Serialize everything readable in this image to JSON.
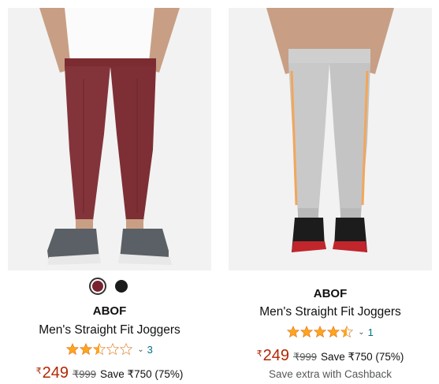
{
  "products": [
    {
      "brand": "ABOF",
      "title": "Men's Straight Fit Joggers",
      "rating": 2.5,
      "review_count": "3",
      "currency": "₹",
      "price": "249",
      "mrp": "₹999",
      "save": "Save ₹750 (75%)",
      "swatches": [
        {
          "name": "maroon",
          "color": "#7a2230",
          "selected": true
        },
        {
          "name": "black",
          "color": "#1b1b1b",
          "selected": false
        }
      ],
      "image_icon": "maroon-joggers-image"
    },
    {
      "brand": "ABOF",
      "title": "Men's Straight Fit Joggers",
      "rating": 4.5,
      "review_count": "1",
      "currency": "₹",
      "price": "249",
      "mrp": "₹999",
      "save": "Save ₹750 (75%)",
      "cashback": "Save extra with Cashback",
      "image_icon": "grey-joggers-image"
    }
  ],
  "colors": {
    "star": "#ffa41c",
    "price": "#b12704",
    "link": "#007185",
    "muted": "#565959"
  }
}
